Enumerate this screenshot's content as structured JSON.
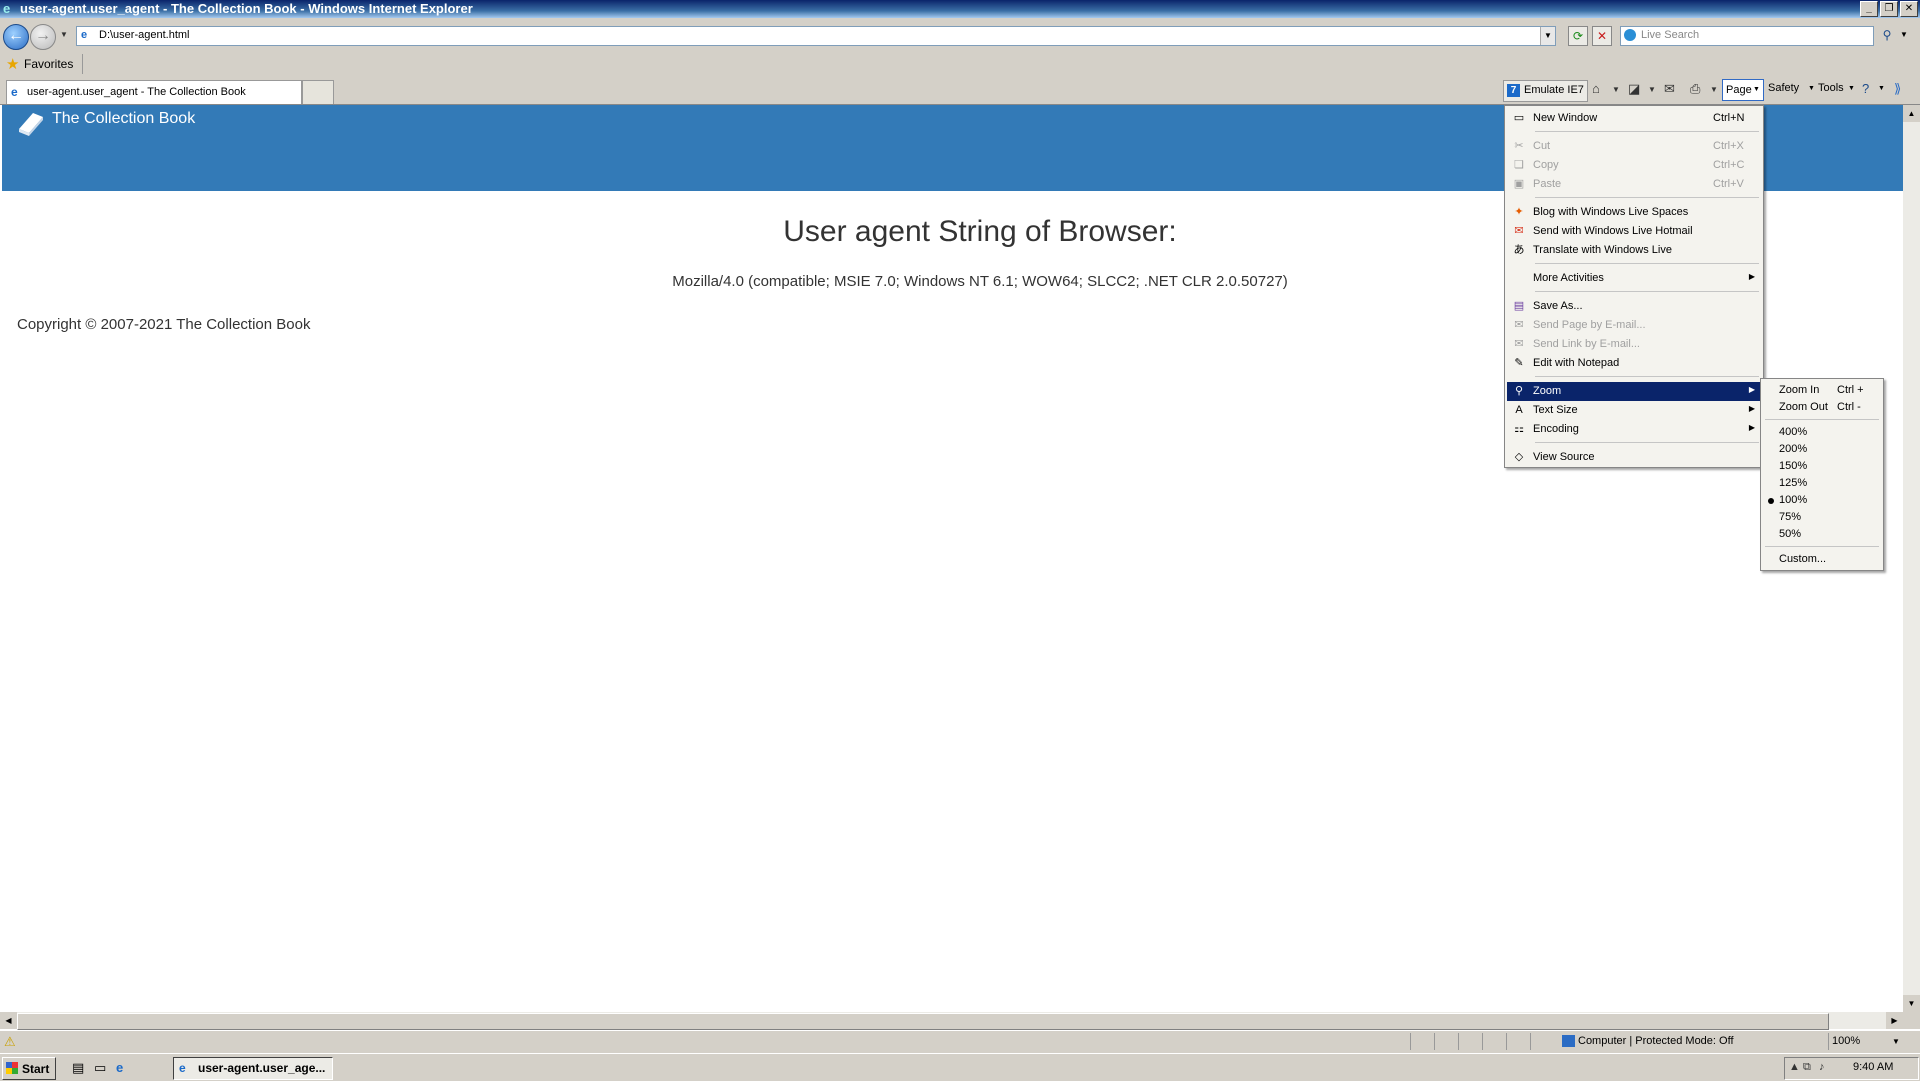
{
  "window": {
    "title": "user-agent.user_agent - The Collection Book - Windows Internet Explorer"
  },
  "nav": {
    "address": "D:\\user-agent.html",
    "search_placeholder": "Live Search"
  },
  "favorites": {
    "label": "Favorites"
  },
  "tab": {
    "title": "user-agent.user_agent - The Collection Book"
  },
  "commandbar": {
    "emulate": "Emulate IE7",
    "page": "Page",
    "safety": "Safety",
    "tools": "Tools"
  },
  "page": {
    "brand": "The Collection Book",
    "heading": "User agent String of Browser:",
    "user_agent": "Mozilla/4.0 (compatible; MSIE 7.0; Windows NT 6.1; WOW64; SLCC2; .NET CLR 2.0.50727)",
    "copyright": "Copyright © 2007-2021 The Collection Book"
  },
  "page_menu": {
    "new_window": {
      "label": "New Window",
      "shortcut": "Ctrl+N"
    },
    "cut": {
      "label": "Cut",
      "shortcut": "Ctrl+X"
    },
    "copy": {
      "label": "Copy",
      "shortcut": "Ctrl+C"
    },
    "paste": {
      "label": "Paste",
      "shortcut": "Ctrl+V"
    },
    "blog": {
      "label": "Blog with Windows Live Spaces"
    },
    "send_hotmail": {
      "label": "Send with Windows Live Hotmail"
    },
    "translate": {
      "label": "Translate with Windows Live"
    },
    "more_activities": {
      "label": "More Activities"
    },
    "save_as": {
      "label": "Save As..."
    },
    "send_page": {
      "label": "Send Page by E-mail..."
    },
    "send_link": {
      "label": "Send Link by E-mail..."
    },
    "edit_notepad": {
      "label": "Edit with Notepad"
    },
    "zoom": {
      "label": "Zoom"
    },
    "text_size": {
      "label": "Text Size"
    },
    "encoding": {
      "label": "Encoding"
    },
    "view_source": {
      "label": "View Source"
    }
  },
  "zoom_menu": {
    "zoom_in": {
      "label": "Zoom In",
      "shortcut": "Ctrl +"
    },
    "zoom_out": {
      "label": "Zoom Out",
      "shortcut": "Ctrl -"
    },
    "levels": [
      "400%",
      "200%",
      "150%",
      "125%",
      "100%",
      "75%",
      "50%"
    ],
    "selected": "100%",
    "custom": "Custom..."
  },
  "statusbar": {
    "zone": "Computer | Protected Mode: Off",
    "zoom": "100%"
  },
  "taskbar": {
    "start": "Start",
    "task": "user-agent.user_age...",
    "clock": "9:40 AM"
  },
  "icons": {
    "back": "back-arrow-icon",
    "forward": "forward-arrow-icon",
    "refresh": "refresh-icon",
    "stop": "stop-icon",
    "search": "search-icon",
    "favorites": "star-icon",
    "home": "home-icon",
    "feeds": "rss-icon",
    "print": "printer-icon",
    "help": "help-icon",
    "zoom": "magnifier-icon"
  }
}
